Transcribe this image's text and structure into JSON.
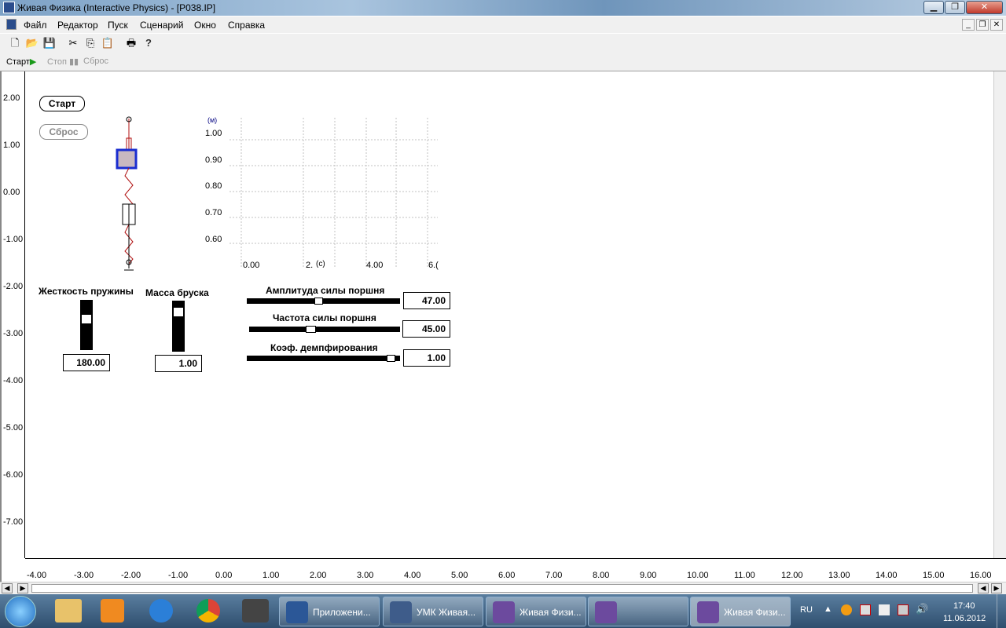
{
  "window": {
    "title": "Живая Физика (Interactive Physics) - [P038.IP]"
  },
  "menu": [
    "Файл",
    "Редактор",
    "Пуск",
    "Сценарий",
    "Окно",
    "Справка"
  ],
  "runbar": {
    "start": "Старт",
    "stop": "Стоп",
    "reset": "Сброс"
  },
  "canvas": {
    "start_button": "Старт",
    "reset_button": "Сброс",
    "spring_label": "Жесткость пружины",
    "spring_value": "180.00",
    "mass_label": "Масса бруска",
    "mass_value": "1.00",
    "amp_label": "Амплитуда силы поршня",
    "amp_value": "47.00",
    "freq_label": "Частота силы поршня",
    "freq_value": "45.00",
    "damp_label": "Коэф. демпфирования",
    "damp_value": "1.00",
    "levels": {
      "spring": 0.35,
      "mass": 0.15,
      "amp": 0.47,
      "freq": 0.4,
      "damp": 0.97
    }
  },
  "graph": {
    "y_unit": "(м)",
    "x_unit": "(с)",
    "y_ticks": [
      "1.00",
      "0.90",
      "0.80",
      "0.70",
      "0.60"
    ],
    "x_ticks": [
      "0.00",
      "2.",
      "4.00",
      "6.("
    ]
  },
  "vruler": [
    "2.00",
    "1.00",
    "0.00",
    "-1.00",
    "-2.00",
    "-3.00",
    "-4.00",
    "-5.00",
    "-6.00",
    "-7.00"
  ],
  "hruler": [
    "-4.00",
    "-3.00",
    "-2.00",
    "-1.00",
    "0.00",
    "1.00",
    "2.00",
    "3.00",
    "4.00",
    "5.00",
    "6.00",
    "7.00",
    "8.00",
    "9.00",
    "10.00",
    "11.00",
    "12.00",
    "13.00",
    "14.00",
    "15.00",
    "16.00"
  ],
  "taskbar": {
    "items": [
      "Приложени...",
      "УМК Живая...",
      "Живая Физи...",
      "",
      "Живая Физи..."
    ],
    "lang": "RU",
    "time": "17:40",
    "date": "11.06.2012"
  }
}
